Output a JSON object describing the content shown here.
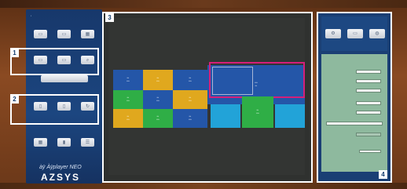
{
  "callouts": [
    "1",
    "2",
    "3",
    "4"
  ],
  "brand": {
    "sub": "àÿ Àÿplayer NEO",
    "name": "AZSYS"
  },
  "left_panel": {
    "row1_caption": [
      "",
      "",
      ""
    ],
    "row2_caption": [
      "",
      "",
      ""
    ],
    "row3_caption": [
      "",
      "",
      ""
    ],
    "row4_caption": [
      "",
      "",
      ""
    ]
  },
  "canvas": {
    "tiles": [
      {
        "color": "blue",
        "lines": [
          "",
          ""
        ]
      },
      {
        "color": "yellow",
        "lines": [
          "",
          ""
        ]
      },
      {
        "color": "blue",
        "lines": [
          "",
          ""
        ]
      },
      {
        "color": "yellow",
        "lines": [
          "",
          ""
        ]
      },
      {
        "color": "blue",
        "lines": [
          "",
          ""
        ]
      },
      {
        "color": "blue",
        "lines": [
          "",
          ""
        ]
      },
      {
        "color": "green",
        "lines": [
          "",
          ""
        ]
      },
      {
        "color": "green",
        "lines": [
          "",
          ""
        ]
      },
      {
        "color": "blue",
        "lines": [
          "",
          ""
        ]
      },
      {
        "color": "yellow",
        "lines": [
          "",
          ""
        ]
      },
      {
        "color": "cyan",
        "lines": [
          "",
          ""
        ]
      },
      {
        "color": "green",
        "lines": [
          "",
          ""
        ]
      },
      {
        "color": "cyan",
        "lines": [
          "",
          ""
        ]
      }
    ]
  },
  "colors": {
    "blue": "#2456a8",
    "yellow": "#e0a81e",
    "green": "#2fae46",
    "cyan": "#22a3d8",
    "highlight": "#d51f7a"
  }
}
